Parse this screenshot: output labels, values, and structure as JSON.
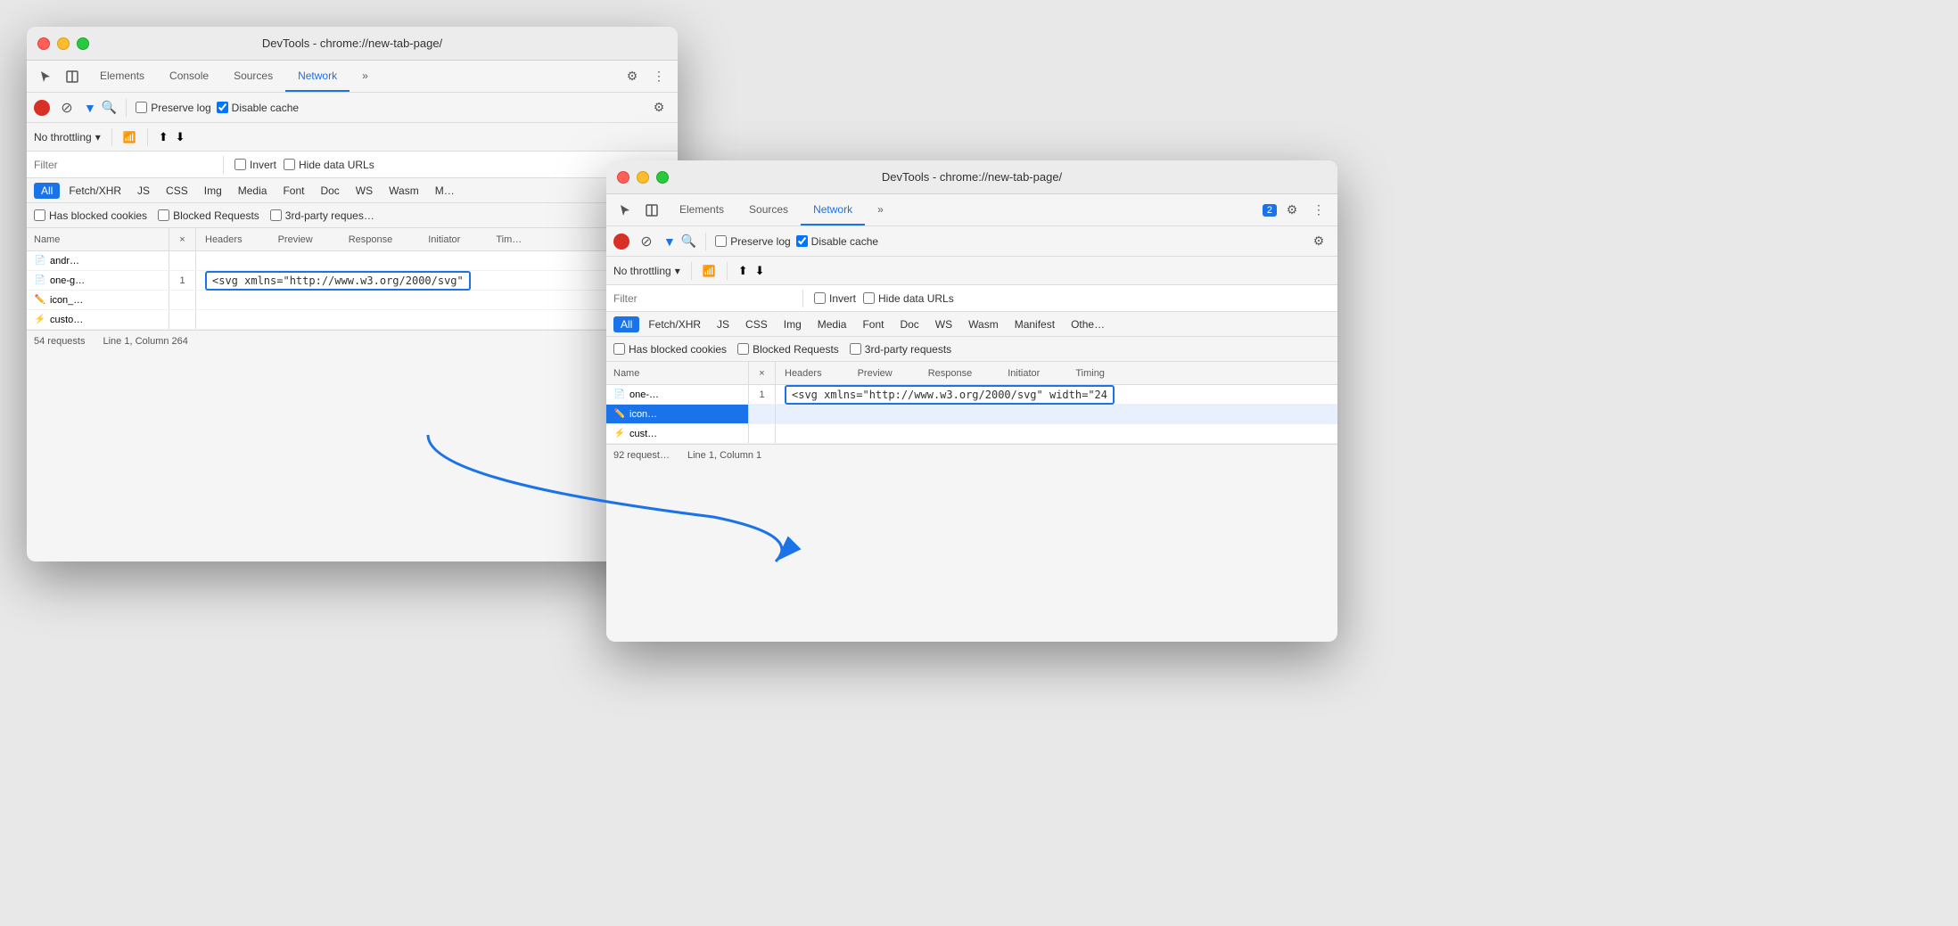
{
  "window1": {
    "title": "DevTools - chrome://new-tab-page/",
    "tabs": [
      "Elements",
      "Console",
      "Sources",
      "Network",
      "»"
    ],
    "active_tab": "Network",
    "network_bar": {
      "preserve_log": "Preserve log",
      "disable_cache": "Disable cache"
    },
    "throttle": "No throttling",
    "filter_placeholder": "Filter",
    "filter_types": [
      "All",
      "Fetch/XHR",
      "JS",
      "CSS",
      "Img",
      "Media",
      "Font",
      "Doc",
      "WS",
      "Wasm",
      "M"
    ],
    "checkboxes": [
      "Has blocked cookies",
      "Blocked Requests",
      "3rd-party reques…"
    ],
    "table_cols": [
      "Name",
      "×",
      "Headers",
      "Preview",
      "Response",
      "Initiator",
      "Tim…"
    ],
    "rows": [
      {
        "icon": "📄",
        "icon_color": "#aaa",
        "name": "andr…",
        "x": "",
        "response": ""
      },
      {
        "icon": "📄",
        "icon_color": "#4285f4",
        "name": "one-g…",
        "x": "1",
        "response": "<svg xmlns=\"http://www.w3.org/2000/svg\""
      },
      {
        "icon": "✏️",
        "icon_color": "#aaa",
        "name": "icon_…",
        "x": "",
        "response": ""
      },
      {
        "icon": "⚡",
        "icon_color": "#f4b400",
        "name": "custo…",
        "x": "",
        "response": ""
      }
    ],
    "status": "54 requests",
    "position": "Line 1, Column 264"
  },
  "window2": {
    "title": "DevTools - chrome://new-tab-page/",
    "tabs": [
      "Elements",
      "Sources",
      "Network",
      "»"
    ],
    "active_tab": "Network",
    "badge": "2",
    "network_bar": {
      "preserve_log": "Preserve log",
      "disable_cache": "Disable cache"
    },
    "throttle": "No throttling",
    "filter_placeholder": "Filter",
    "filter_types": [
      "All",
      "Fetch/XHR",
      "JS",
      "CSS",
      "Img",
      "Media",
      "Font",
      "Doc",
      "WS",
      "Wasm",
      "Manifest",
      "Othe…"
    ],
    "checkboxes": [
      "Has blocked cookies",
      "Blocked Requests",
      "3rd-party requests"
    ],
    "table_cols": [
      "Name",
      "×",
      "Headers",
      "Preview",
      "Response",
      "Initiator",
      "Timing"
    ],
    "rows": [
      {
        "icon": "📄",
        "icon_color": "#4285f4",
        "name": "one-…",
        "x": "1",
        "response": "<svg xmlns=\"http://www.w3.org/2000/svg\" width=\"24"
      },
      {
        "icon": "✏️",
        "icon_color": "#aaa",
        "name": "icon…",
        "x": "",
        "response": "",
        "selected": true
      },
      {
        "icon": "⚡",
        "icon_color": "#f4b400",
        "name": "cust…",
        "x": "",
        "response": ""
      }
    ],
    "status": "92 request…",
    "position": "Line 1, Column 1"
  },
  "icons": {
    "cursor": "⬆",
    "panels": "⬜",
    "more": "⋮",
    "record": "●",
    "stop": "⊘",
    "filter": "▼",
    "search": "🔍",
    "upload": "⬆",
    "download": "⬇",
    "gear": "⚙",
    "wifi": "📶",
    "chat": "💬"
  }
}
